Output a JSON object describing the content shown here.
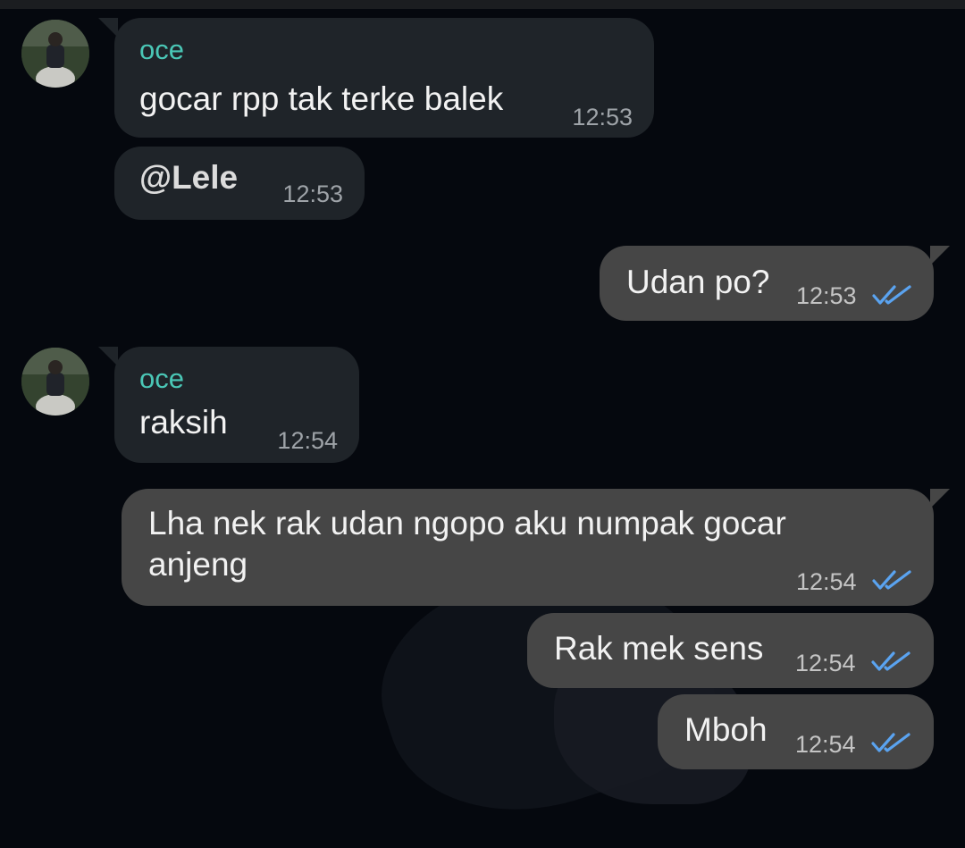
{
  "messages": [
    {
      "sender": "oce",
      "text": "gocar rpp tak terke balek",
      "time": "12:53"
    },
    {
      "text": "@Lele",
      "time": "12:53"
    },
    {
      "text": "Udan po?",
      "time": "12:53",
      "status_icon": "double-check-icon"
    },
    {
      "sender": "oce",
      "text": "raksih",
      "time": "12:54"
    },
    {
      "text": "Lha nek rak udan ngopo aku numpak gocar anjeng",
      "time": "12:54",
      "status_icon": "double-check-icon"
    },
    {
      "text": "Rak mek sens",
      "time": "12:54",
      "status_icon": "double-check-icon"
    },
    {
      "text": "Mboh",
      "time": "12:54",
      "status_icon": "double-check-icon"
    }
  ],
  "colors": {
    "background": "#05080e",
    "incoming_bubble": "#1f2429",
    "outgoing_bubble": "#464646",
    "sender_name": "#4ac7b6",
    "read_check": "#5aa3f0"
  }
}
